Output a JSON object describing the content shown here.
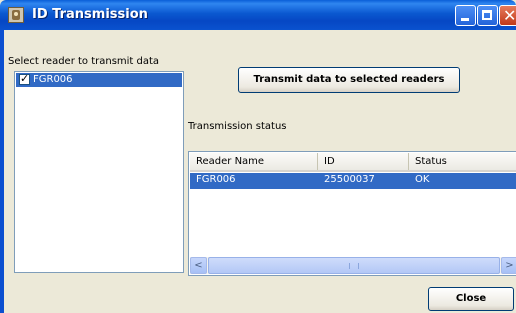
{
  "window": {
    "title": "ID Transmission"
  },
  "titlebar_buttons": {
    "close_glyph": "✕"
  },
  "left_panel": {
    "prompt": "Select reader to transmit data",
    "readers": [
      {
        "name": "FGR006",
        "checked": true,
        "selected": true
      }
    ]
  },
  "transmit_button_label": "Transmit data to selected readers",
  "status_section": {
    "label": "Transmission status",
    "columns": [
      "Reader Name",
      "ID",
      "Status"
    ],
    "rows": [
      {
        "reader_name": "FGR006",
        "id": "25500037",
        "status": "OK"
      }
    ]
  },
  "scrollbar": {
    "left_arrow": "<",
    "right_arrow": ">"
  },
  "close_button_label": "Close",
  "colors": {
    "title_bar": "#0a58d0",
    "selection": "#316ac5",
    "dialog_bg": "#ece9d8"
  }
}
